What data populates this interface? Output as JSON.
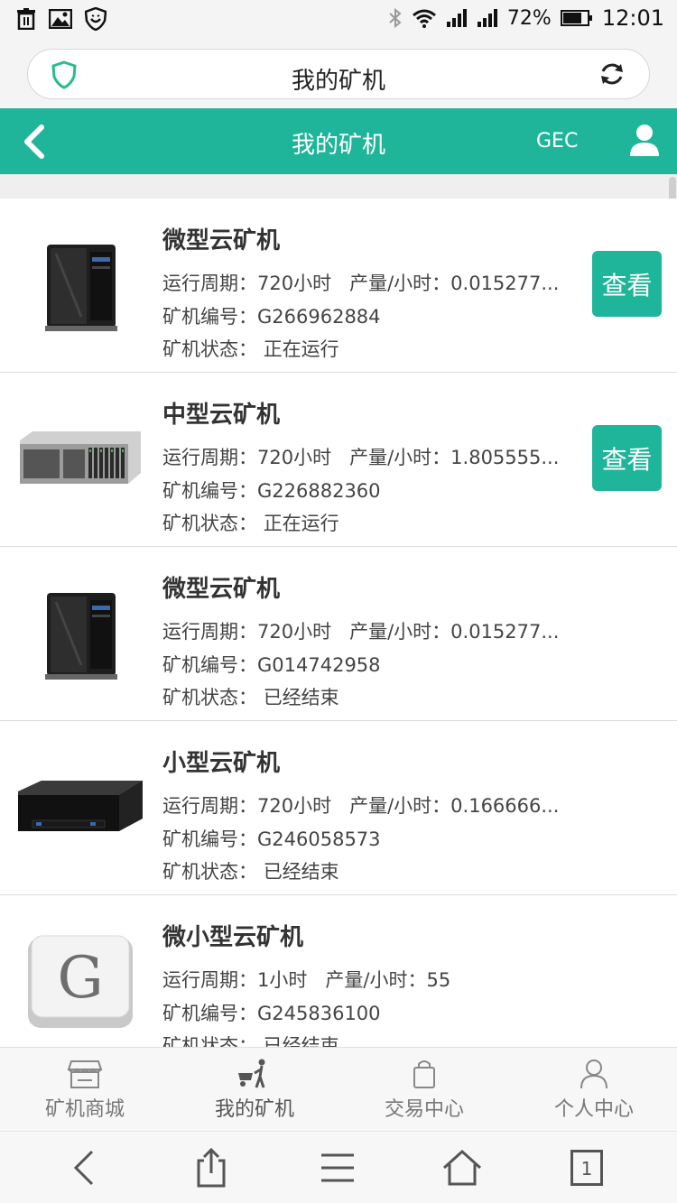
{
  "status_bar": {
    "battery_percent": "72%",
    "time": "12:01",
    "icons": [
      "trash-icon",
      "image-icon",
      "shield-icon",
      "bluetooth-icon",
      "wifi-icon",
      "signal-icon",
      "signal-icon",
      "battery-icon"
    ]
  },
  "browser": {
    "url_title": "我的矿机"
  },
  "header": {
    "title": "我的矿机",
    "right_text": "GEC"
  },
  "colors": {
    "accent": "#1fb59a"
  },
  "miners": [
    {
      "name": "微型云矿机",
      "period_label": "运行周期：",
      "period": "720小时",
      "output_label": "产量/小时：",
      "output": "0.015277...",
      "id_label": "矿机编号：",
      "id": "G266962884",
      "status_label": "矿机状态：",
      "status": "正在运行",
      "button": "查看",
      "image": "micro-server-icon"
    },
    {
      "name": "中型云矿机",
      "period_label": "运行周期：",
      "period": "720小时",
      "output_label": "产量/小时：",
      "output": "1.805555...",
      "id_label": "矿机编号：",
      "id": "G226882360",
      "status_label": "矿机状态：",
      "status": "正在运行",
      "button": "查看",
      "image": "rack-server-icon"
    },
    {
      "name": "微型云矿机",
      "period_label": "运行周期：",
      "period": "720小时",
      "output_label": "产量/小时：",
      "output": "0.015277...",
      "id_label": "矿机编号：",
      "id": "G014742958",
      "status_label": "矿机状态：",
      "status": "已经结束",
      "image": "micro-server-icon"
    },
    {
      "name": "小型云矿机",
      "period_label": "运行周期：",
      "period": "720小时",
      "output_label": "产量/小时：",
      "output": "0.166666...",
      "id_label": "矿机编号：",
      "id": "G246058573",
      "status_label": "矿机状态：",
      "status": "已经结束",
      "image": "flat-server-icon"
    },
    {
      "name": "微小型云矿机",
      "period_label": "运行周期：",
      "period": "1小时",
      "output_label": "产量/小时：",
      "output": "55",
      "id_label": "矿机编号：",
      "id": "G245836100",
      "status_label": "矿机状态：",
      "status": "已经结束",
      "image": "g-key-icon"
    }
  ],
  "tabbar": {
    "items": [
      {
        "label": "矿机商城",
        "icon": "shop-icon"
      },
      {
        "label": "我的矿机",
        "icon": "miner-cart-icon"
      },
      {
        "label": "交易中心",
        "icon": "bag-icon"
      },
      {
        "label": "个人中心",
        "icon": "person-icon"
      }
    ],
    "active_index": 1
  },
  "browser_toolbar": {
    "tab_count": "1",
    "icons": [
      "back-icon",
      "share-icon",
      "menu-icon",
      "home-icon",
      "tabs-icon"
    ]
  }
}
